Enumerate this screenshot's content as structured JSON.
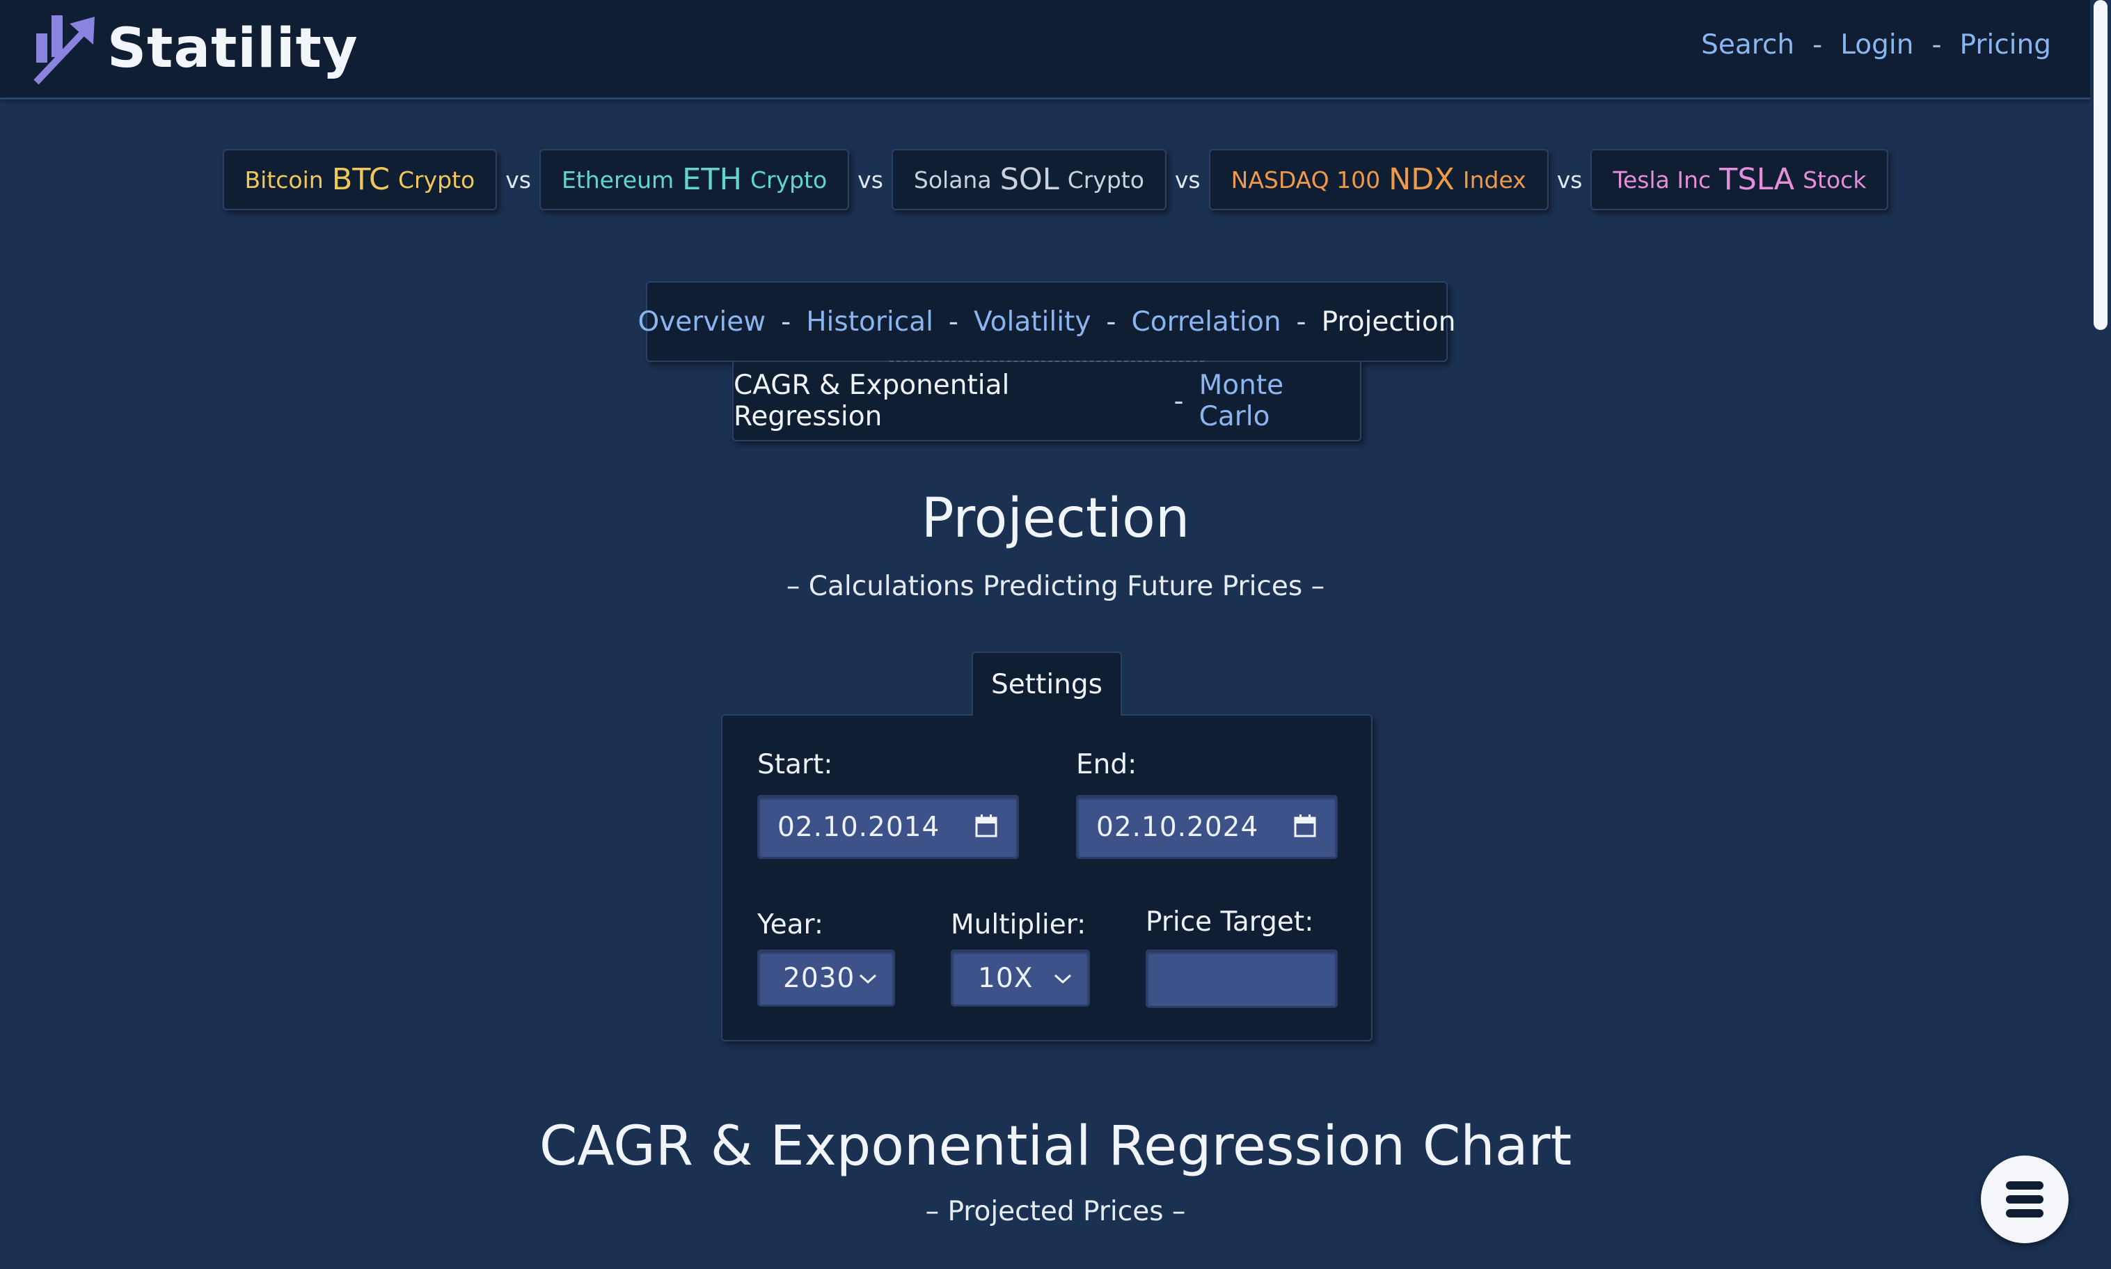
{
  "header": {
    "brand": "Statility",
    "nav": [
      {
        "label": "Search"
      },
      {
        "label": "Login"
      },
      {
        "label": "Pricing"
      }
    ],
    "separator": "-"
  },
  "assets": {
    "vs_label": "vs",
    "items": [
      {
        "name": "Bitcoin",
        "ticker": "BTC",
        "kind": "Crypto",
        "color": "#f0c85a"
      },
      {
        "name": "Ethereum",
        "ticker": "ETH",
        "kind": "Crypto",
        "color": "#62d6cd"
      },
      {
        "name": "Solana",
        "ticker": "SOL",
        "kind": "Crypto",
        "color": "#c9d2de"
      },
      {
        "name": "NASDAQ 100",
        "ticker": "NDX",
        "kind": "Index",
        "color": "#ef9a4a"
      },
      {
        "name": "Tesla Inc",
        "ticker": "TSLA",
        "kind": "Stock",
        "color": "#e58ed9"
      }
    ]
  },
  "section_nav": {
    "row1": [
      "Overview",
      "Historical",
      "Volatility",
      "Correlation",
      "Projection"
    ],
    "row2": [
      "CAGR & Exponential Regression",
      "Monte Carlo"
    ],
    "current_row1": "Projection",
    "current_row2": "CAGR & Exponential Regression",
    "separator": "-"
  },
  "page": {
    "title": "Projection",
    "subtitle": "– Calculations Predicting Future Prices –"
  },
  "settings": {
    "tab_label": "Settings",
    "start_label": "Start:",
    "start_value": "02.10.2014",
    "end_label": "End:",
    "end_value": "02.10.2024",
    "year_label": "Year:",
    "year_value": "2030",
    "multiplier_label": "Multiplier:",
    "multiplier_value": "10X",
    "price_target_label": "Price Target:",
    "price_target_value": ""
  },
  "chart_section": {
    "title": "CAGR & Exponential Regression Chart",
    "subtitle": "– Projected Prices –"
  },
  "icons": {
    "logo": "chart-arrow-logo",
    "calendar": "calendar-icon",
    "chevron": "chevron-down-icon",
    "menu": "hamburger-menu-icon"
  }
}
